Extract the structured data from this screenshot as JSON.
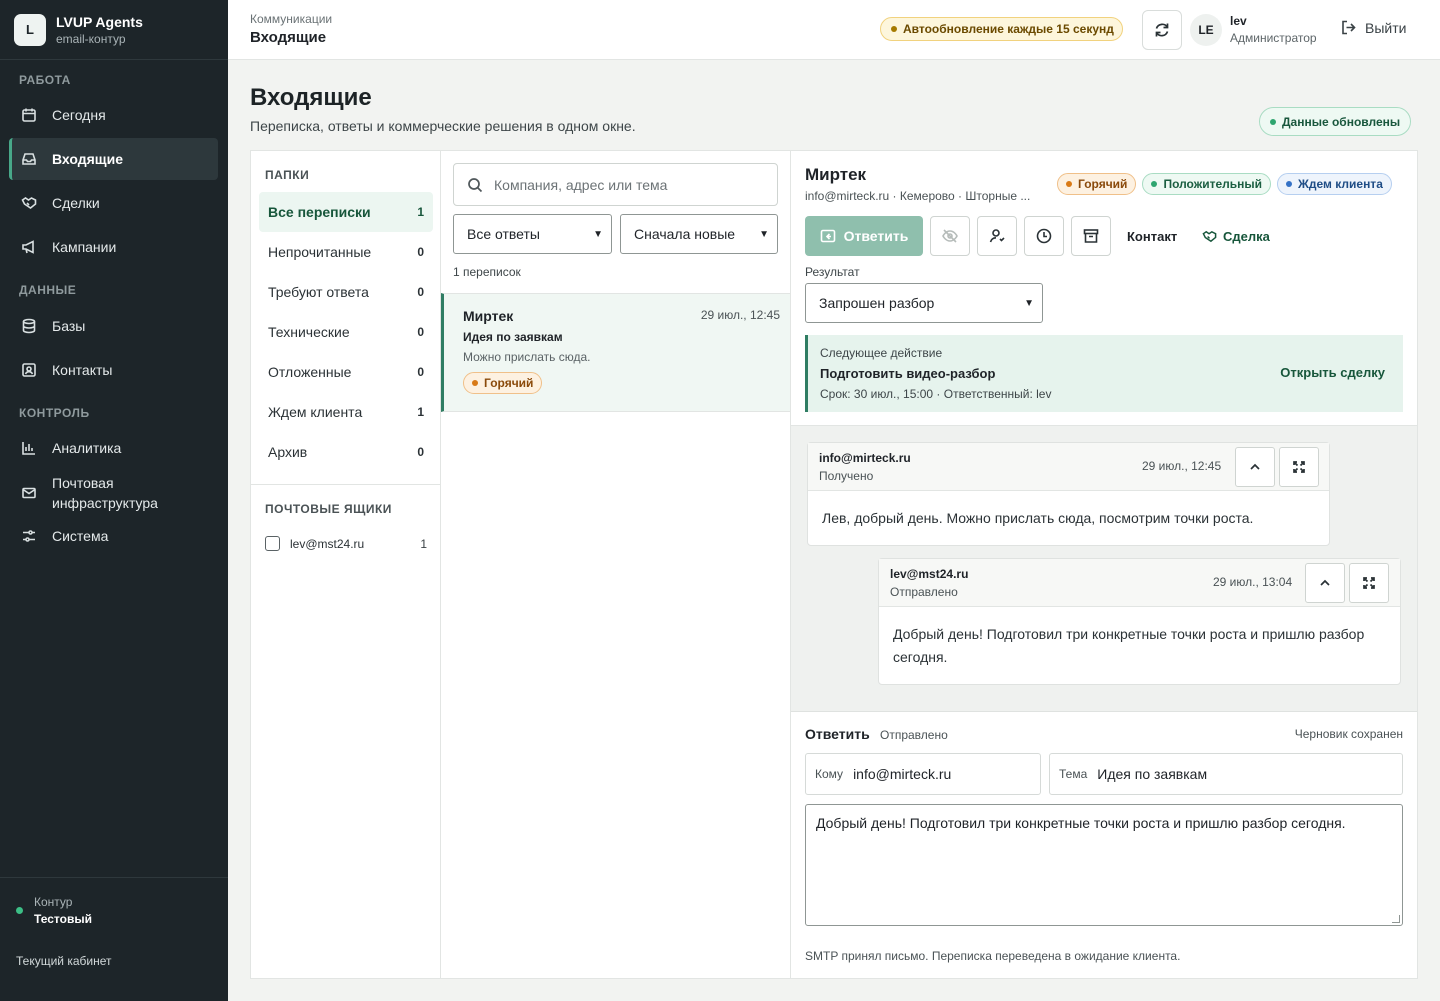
{
  "brand": {
    "logo": "L",
    "title": "LVUP Agents",
    "subtitle": "email-контур"
  },
  "sidebar": {
    "sections": {
      "work": "РАБОТА",
      "data": "ДАННЫЕ",
      "control": "КОНТРОЛЬ"
    },
    "items": [
      {
        "label": "Сегодня",
        "icon": "calendar-icon"
      },
      {
        "label": "Входящие",
        "icon": "inbox-icon",
        "active": true
      },
      {
        "label": "Сделки",
        "icon": "handshake-icon"
      },
      {
        "label": "Кампании",
        "icon": "megaphone-icon"
      },
      {
        "label": "Базы",
        "icon": "database-icon"
      },
      {
        "label": "Контакты",
        "icon": "contact-card-icon"
      },
      {
        "label": "Аналитика",
        "icon": "bar-chart-icon"
      },
      {
        "label": "Почтовая инфраструктура",
        "icon": "mail-icon"
      },
      {
        "label": "Система",
        "icon": "settings-sliders-icon"
      }
    ],
    "footer": {
      "env_label": "Контур",
      "env_value": "Тестовый",
      "cabinet": "Текущий кабинет",
      "env_color": "#3cbf86"
    }
  },
  "topbar": {
    "breadcrumb": "Коммуникации",
    "title": "Входящие",
    "auto_refresh": "Автообновление каждые 15 секунд",
    "avatar": "LE",
    "user_name": "lev",
    "user_role": "Администратор",
    "logout": "Выйти"
  },
  "page": {
    "title": "Входящие",
    "subtitle": "Переписка, ответы и коммерческие решения в одном окне.",
    "updated_badge": "Данные обновлены"
  },
  "folders": {
    "heading": "ПАПКИ",
    "items": [
      {
        "label": "Все переписки",
        "count": "1",
        "active": true
      },
      {
        "label": "Непрочитанные",
        "count": "0"
      },
      {
        "label": "Требуют ответа",
        "count": "0"
      },
      {
        "label": "Технические",
        "count": "0"
      },
      {
        "label": "Отложенные",
        "count": "0"
      },
      {
        "label": "Ждем клиента",
        "count": "1"
      },
      {
        "label": "Архив",
        "count": "0"
      }
    ],
    "mailboxes_heading": "ПОЧТОВЫЕ ЯЩИКИ",
    "mailboxes": [
      {
        "address": "lev@mst24.ru",
        "count": "1",
        "checked": false
      }
    ]
  },
  "threads": {
    "search_placeholder": "Компания, адрес или тема",
    "filter_value": "Все ответы",
    "sort_value": "Сначала новые",
    "count_text": "1 переписок",
    "items": [
      {
        "company": "Миртек",
        "date": "29 июл., 12:45",
        "subject": "Идея по заявкам",
        "preview": "Можно прислать сюда.",
        "tag": "Горячий"
      }
    ]
  },
  "detail": {
    "company": "Миртек",
    "meta": "info@mirteck.ru · Кемерово · Шторные ...",
    "tags": [
      "Горячий",
      "Положительный",
      "Ждем клиента"
    ],
    "reply_label": "Ответить",
    "contact_link": "Контакт",
    "deal_link": "Сделка",
    "result_label": "Результат",
    "result_value": "Запрошен разбор",
    "next_action": {
      "label": "Следующее действие",
      "title": "Подготовить видео-разбор",
      "meta": "Срок: 30 июл., 15:00 · Ответственный: lev",
      "link": "Открыть сделку"
    },
    "messages": [
      {
        "from": "info@mirteck.ru",
        "status": "Получено",
        "date": "29 июл., 12:45",
        "body": "Лев, добрый день. Можно прислать сюда, посмотрим точки роста."
      },
      {
        "from": "lev@mst24.ru",
        "status": "Отправлено",
        "date": "29 июл., 13:04",
        "body": "Добрый день! Подготовил три конкретные точки роста и пришлю разбор сегодня."
      }
    ],
    "composer": {
      "title": "Ответить",
      "status": "Отправлено",
      "draft": "Черновик сохранен",
      "to_label": "Кому",
      "to_value": "info@mirteck.ru",
      "subject_label": "Тема",
      "subject_value": "Идея по заявкам",
      "body": "Добрый день! Подготовил три конкретные точки роста и пришлю разбор сегодня.",
      "footer": "SMTP принял письмо. Переписка переведена в ожидание клиента."
    }
  },
  "colors": {
    "accent": "#2f7d63",
    "sidebar_bg": "#1d2529",
    "primary_button": "#8fbfad"
  }
}
